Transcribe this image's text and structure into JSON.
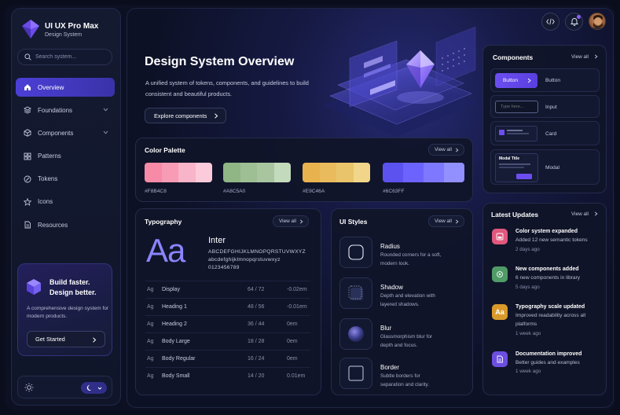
{
  "brand": {
    "title": "UI UX Pro Max",
    "subtitle": "Design System"
  },
  "search": {
    "placeholder": "Search system..."
  },
  "nav": [
    {
      "label": "Overview",
      "icon": "home-icon",
      "active": true
    },
    {
      "label": "Foundations",
      "icon": "layers-icon",
      "expandable": true
    },
    {
      "label": "Components",
      "icon": "cube-icon",
      "expandable": true
    },
    {
      "label": "Patterns",
      "icon": "grid-icon"
    },
    {
      "label": "Tokens",
      "icon": "token-icon"
    },
    {
      "label": "Icons",
      "icon": "star-icon"
    },
    {
      "label": "Resources",
      "icon": "document-icon"
    }
  ],
  "promo": {
    "title_line1": "Build faster.",
    "title_line2": "Design better.",
    "description": "A comprehensive design system for modern products.",
    "button": "Get Started"
  },
  "hero": {
    "title": "Design System Overview",
    "description": "A unified system of tokens, components, and guidelines to build consistent and beautiful products.",
    "button": "Explore components"
  },
  "palette": {
    "title": "Color Palette",
    "view_all": "View all",
    "swatches": [
      {
        "hex": "#F8B4C8",
        "shades": [
          "#f78aa6",
          "#f89bb4",
          "#f8b4c8",
          "#fbcadb"
        ]
      },
      {
        "hex": "#A8C5A0",
        "shades": [
          "#8fb684",
          "#9dbf93",
          "#a8c5a0",
          "#c3dabd"
        ]
      },
      {
        "hex": "#E9C46A",
        "shades": [
          "#e8b24f",
          "#e9bb5c",
          "#e9c46a",
          "#f1d689"
        ]
      },
      {
        "hex": "#6C63FF",
        "shades": [
          "#5b52f0",
          "#6c63ff",
          "#7d78ff",
          "#9290ff"
        ]
      }
    ]
  },
  "typography": {
    "title": "Typography",
    "view_all": "View all",
    "sample": "Aa",
    "font_name": "Inter",
    "uppercase": "ABCDEFGHIJKLMNOPQRSTUVWXYZ",
    "lowercase": "abcdefghijklmnopqrstuvwxyz",
    "digits": "0123456789",
    "rows": [
      {
        "ag": "Ag",
        "name": "Display",
        "size": "64 / 72",
        "tracking": "-0.02em"
      },
      {
        "ag": "Ag",
        "name": "Heading 1",
        "size": "48 / 56",
        "tracking": "-0.01em"
      },
      {
        "ag": "Ag",
        "name": "Heading 2",
        "size": "36 / 44",
        "tracking": "0em"
      },
      {
        "ag": "Ag",
        "name": "Body Large",
        "size": "18 / 28",
        "tracking": "0em"
      },
      {
        "ag": "Ag",
        "name": "Body Regular",
        "size": "16 / 24",
        "tracking": "0em"
      },
      {
        "ag": "Ag",
        "name": "Body Small",
        "size": "14 / 20",
        "tracking": "0.01em"
      }
    ]
  },
  "ui_styles": {
    "title": "UI Styles",
    "view_all": "View all",
    "items": [
      {
        "title": "Radius",
        "desc": "Rounded corners for a soft, modern look."
      },
      {
        "title": "Shadow",
        "desc": "Depth and elevation with layered shadows."
      },
      {
        "title": "Blur",
        "desc": "Glassmorphism blur for depth and focus."
      },
      {
        "title": "Border",
        "desc": "Subtle borders for separation and clarity."
      }
    ]
  },
  "components": {
    "title": "Components",
    "view_all": "View all",
    "button_sample": "Button",
    "input_placeholder": "Type here...",
    "modal_title": "Modal Title",
    "labels": [
      "Button",
      "Input",
      "Card",
      "Modal"
    ]
  },
  "updates": {
    "title": "Latest Updates",
    "view_all": "View all",
    "items": [
      {
        "title": "Color system expanded",
        "desc": "Added 12 new semantic tokens",
        "time": "2 days ago",
        "color": "#e0587e"
      },
      {
        "title": "New components added",
        "desc": "6 new components in library",
        "time": "5 days ago",
        "color": "#4f9c67"
      },
      {
        "title": "Typography scale updated",
        "desc": "Improved readability across all platforms",
        "time": "1 week ago",
        "color": "#d99a2b",
        "glyph": "Aa"
      },
      {
        "title": "Documentation improved",
        "desc": "Better guides and examples",
        "time": "1 week ago",
        "color": "#6c4ee0"
      }
    ]
  }
}
